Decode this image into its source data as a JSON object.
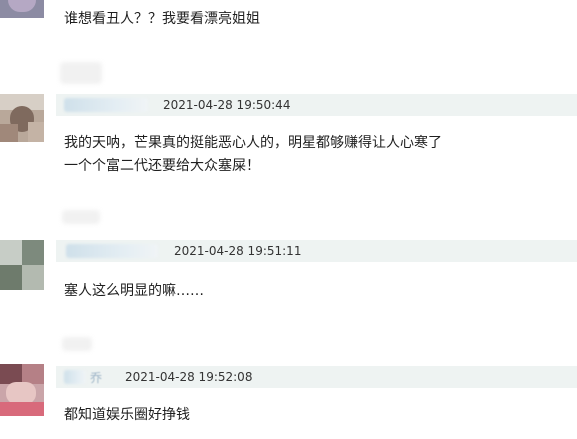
{
  "comments": [
    {
      "text_lines": [
        "谁想看丑人？？我要看漂亮姐姐"
      ]
    },
    {
      "timestamp": "2021-04-28 19:50:44",
      "text_lines": [
        "我的天呐，芒果真的挺能恶心人的，明星都够赚得让人心寒了",
        "一个个富二代还要给大众塞屎！"
      ]
    },
    {
      "timestamp": "2021-04-28 19:51:11",
      "text_lines": [
        "塞人这么明显的嘛……"
      ]
    },
    {
      "name_fragment": "乔",
      "timestamp": "2021-04-28 19:52:08",
      "text_lines": [
        "都知道娱乐圈好挣钱"
      ]
    }
  ],
  "colors": {
    "meta_bar": "#eef3f2",
    "text": "#1f1f1f",
    "timestamp": "#333333"
  }
}
